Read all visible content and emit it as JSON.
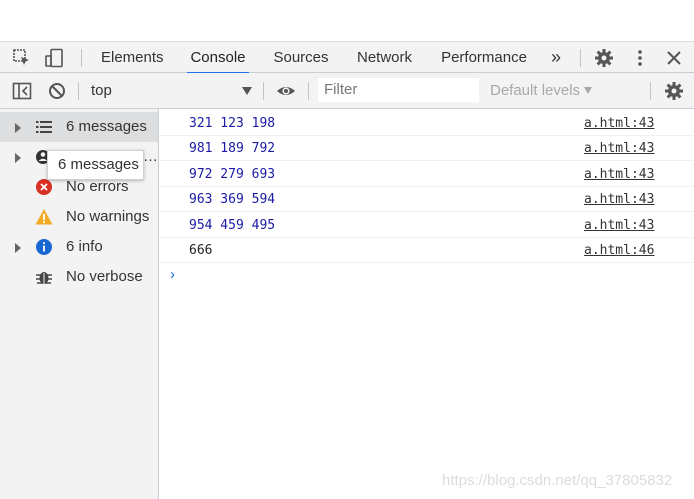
{
  "tabs": [
    "Elements",
    "Console",
    "Sources",
    "Network",
    "Performance"
  ],
  "more_tabs_glyph": "»",
  "toolbar": {
    "context": "top",
    "filter_placeholder": "Filter",
    "levels": "Default levels"
  },
  "sidebar": {
    "items": [
      {
        "label": "6 messages",
        "icon": "list-icon"
      },
      {
        "label": "…",
        "icon": "user-messages-icon"
      },
      {
        "label": "No errors",
        "icon": "error-icon"
      },
      {
        "label": "No warnings",
        "icon": "warning-icon"
      },
      {
        "label": "6 info",
        "icon": "info-icon"
      },
      {
        "label": "No verbose",
        "icon": "bug-icon"
      }
    ],
    "tooltip": "6 messages"
  },
  "console": {
    "messages": [
      {
        "text": "321 123 198",
        "source": "a.html:43"
      },
      {
        "text": "981 189 792",
        "source": "a.html:43"
      },
      {
        "text": "972 279 693",
        "source": "a.html:43"
      },
      {
        "text": "963 369 594",
        "source": "a.html:43"
      },
      {
        "text": "954 459 495",
        "source": "a.html:43"
      },
      {
        "text": "666",
        "source": "a.html:46"
      }
    ],
    "prompt": "›"
  },
  "watermark": "https://blog.csdn.net/qq_37805832",
  "colors": {
    "accent": "#1a73e8",
    "number": "#1a1aa6",
    "error": "#d93025",
    "warning": "#f2ab26",
    "info": "#1967d2"
  }
}
